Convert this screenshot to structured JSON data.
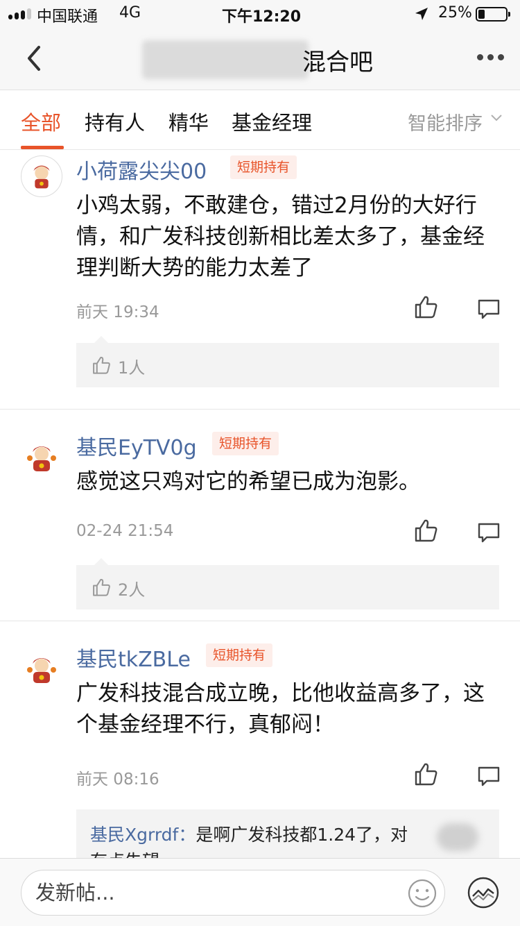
{
  "status_bar": {
    "carrier": "中国联通",
    "network": "4G",
    "time": "下午12:20",
    "battery": "25%",
    "battery_level": 0.25,
    "signal_bars": 3
  },
  "nav": {
    "title": "混合吧"
  },
  "tabs": [
    {
      "label": "全部",
      "active": true
    },
    {
      "label": "持有人",
      "active": false
    },
    {
      "label": "精华",
      "active": false
    },
    {
      "label": "基金经理",
      "active": false
    }
  ],
  "sort": {
    "label": "智能排序"
  },
  "posts": [
    {
      "username": "小荷露尖尖00",
      "tag": "短期持有",
      "content": "小鸡太弱，不敢建仓，错过2月份的大好行情，和广发科技创新相比差太多了，基金经理判断大势的能力太差了",
      "time": "前天 19:34",
      "likes": "1人"
    },
    {
      "username": "基民EyTV0g",
      "tag": "短期持有",
      "content": "感觉这只鸡对它的希望已成为泡影。",
      "time": "02-24 21:54",
      "likes": "2人"
    },
    {
      "username": "基民tkZBLe",
      "tag": "短期持有",
      "content": "广发科技混合成立晚，比他收益高多了，这个基金经理不行，真郁闷！",
      "time": "前天 08:16",
      "reply": {
        "name": "基民Xgrrdf：",
        "text": "是啊广发科技都1.24了，对",
        "text2": "有点失望。"
      }
    }
  ],
  "compose": {
    "placeholder": "发新帖..."
  },
  "colors": {
    "accent": "#e8542a",
    "username": "#4a6aa0",
    "tag_bg": "#fdeeea"
  },
  "icons": [
    "back-arrow-icon",
    "more-dots-icon",
    "chevron-down-icon",
    "thumbs-up-icon",
    "comment-icon",
    "emoji-icon",
    "trend-chart-icon",
    "location-arrow-icon",
    "battery-icon",
    "signal-icon"
  ]
}
